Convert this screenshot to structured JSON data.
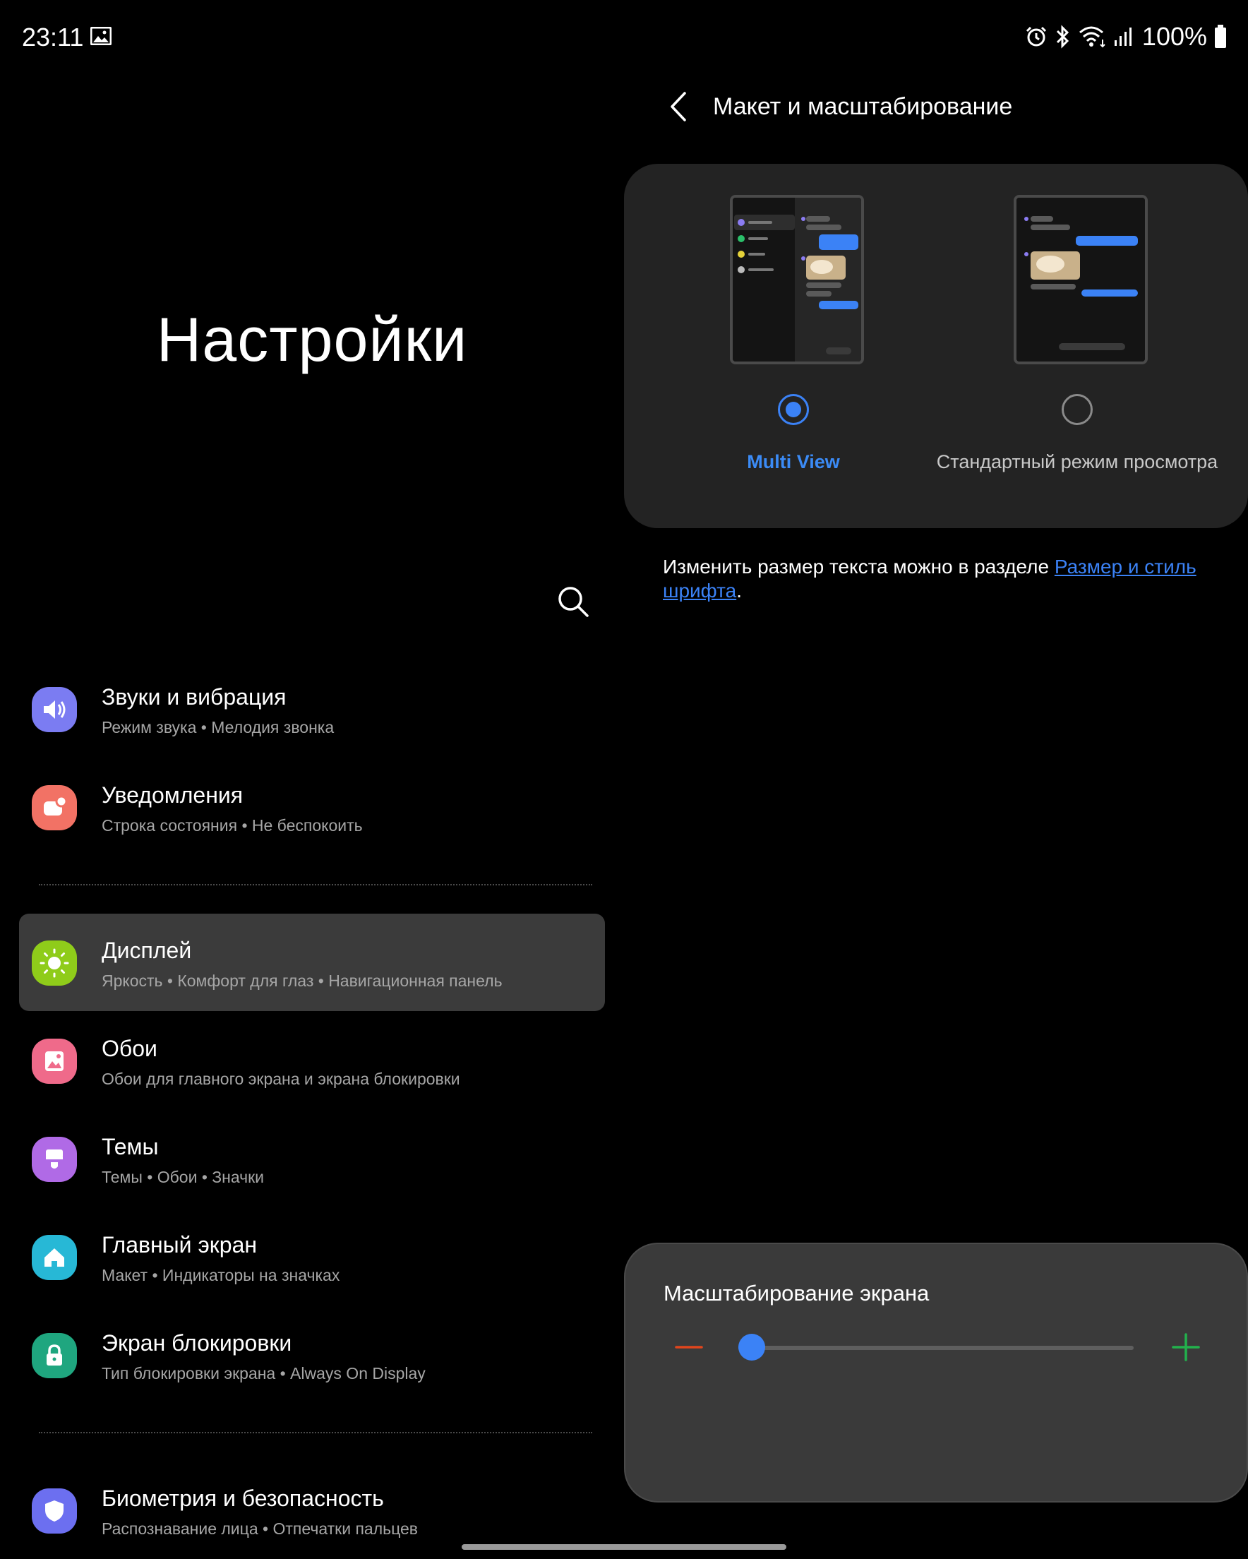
{
  "status_bar": {
    "time": "23:11",
    "battery": "100%"
  },
  "left": {
    "title": "Настройки",
    "menu": [
      {
        "title": "Звуки и вибрация",
        "subtitle": "Режим звука  •  Мелодия звонка",
        "icon": "speaker-icon",
        "color": "#7b7cf2"
      },
      {
        "title": "Уведомления",
        "subtitle": "Строка состояния  •  Не беспокоить",
        "icon": "notification-icon",
        "color": "#f27265"
      },
      {
        "title": "Дисплей",
        "subtitle": "Яркость  •  Комфорт для глаз  •  Навигационная панель",
        "icon": "sun-icon",
        "color": "#8fcc1a"
      },
      {
        "title": "Обои",
        "subtitle": "Обои для главного экрана и экрана блокировки",
        "icon": "image-icon",
        "color": "#ef6a8a"
      },
      {
        "title": "Темы",
        "subtitle": "Темы  •  Обои  •  Значки",
        "icon": "brush-icon",
        "color": "#b06ae6"
      },
      {
        "title": "Главный экран",
        "subtitle": "Макет  •  Индикаторы на значках",
        "icon": "home-icon",
        "color": "#27b8d6"
      },
      {
        "title": "Экран блокировки",
        "subtitle": "Тип блокировки экрана  •  Always On Display",
        "icon": "lock-icon",
        "color": "#1fa67f"
      },
      {
        "title": "Биометрия и безопасность",
        "subtitle": "Распознавание лица  •  Отпечатки пальцев",
        "icon": "shield-icon",
        "color": "#6c6ff0"
      }
    ]
  },
  "right": {
    "title": "Макет и масштабирование",
    "options": [
      {
        "label": "Multi View",
        "selected": true
      },
      {
        "label": "Стандартный режим просмотра",
        "selected": false
      }
    ],
    "hint_prefix": "Изменить размер текста можно в разделе ",
    "hint_link": "Размер и стиль шрифта",
    "hint_suffix": ".",
    "zoom": {
      "title": "Масштабирование экрана",
      "level": 0.0
    }
  },
  "colors": {
    "accent": "#3b82f6",
    "minus": "#e0451c",
    "plus": "#22b14c",
    "selected_row": "#3b3b3b"
  }
}
